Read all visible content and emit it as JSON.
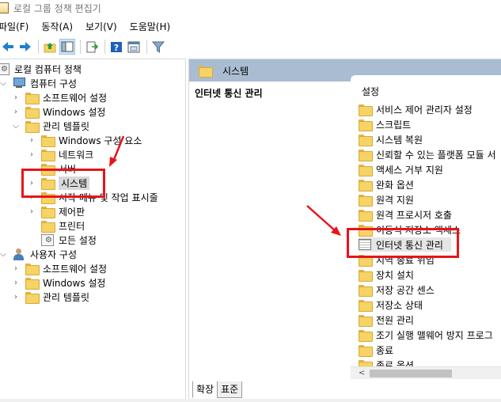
{
  "window": {
    "title": "로컬 그룹 정책 편집기"
  },
  "menu": [
    "파일(F)",
    "동작(A)",
    "보기(V)",
    "도움말(H)"
  ],
  "toolbar": {
    "icons": [
      "back-arrow-icon",
      "forward-arrow-icon",
      "up-folder-icon",
      "show-hide-tree-icon",
      "export-list-icon",
      "help-icon",
      "properties-icon",
      "filter-icon"
    ]
  },
  "tree": {
    "root": "로컬 컴퓨터 정책",
    "computer_config": "컴퓨터 구성",
    "cc_software": "소프트웨어 설정",
    "cc_windows": "Windows 설정",
    "cc_admin": "관리 템플릿",
    "admin_children": [
      "Windows 구성 요소",
      "네트워크",
      "서버",
      "시스템",
      "시작 메뉴 및 작업 표시줄",
      "제어판",
      "프린터",
      "모든 설정"
    ],
    "user_config": "사용자 구성",
    "uc_software": "소프트웨어 설정",
    "uc_windows": "Windows 설정",
    "uc_admin": "관리 템플릿",
    "selected": "시스템"
  },
  "right": {
    "header": "시스템",
    "desc_title": "인터넷 통신 관리",
    "column": "설정",
    "items": [
      "서비스 제어 관리자 설정",
      "스크립트",
      "시스템 복원",
      "신뢰할 수 있는 플랫폼 모듈 서",
      "액세스 거부 지원",
      "완화 옵션",
      "원격 지원",
      "원격 프로시저 호출",
      "이동식 저장소 액세스",
      "인터넷 통신 관리",
      "지역 종료 위임",
      "장치 설치",
      "저장 공간 센스",
      "저장소 상태",
      "전원 관리",
      "조기 실행 맬웨어 방지 프로그",
      "종료",
      "종료 옵션"
    ],
    "highlighted": "인터넷 통신 관리"
  },
  "tabs": [
    "확장",
    "표준"
  ],
  "colors": {
    "annotation": "#e8141b",
    "header": "#a9bcd2"
  }
}
